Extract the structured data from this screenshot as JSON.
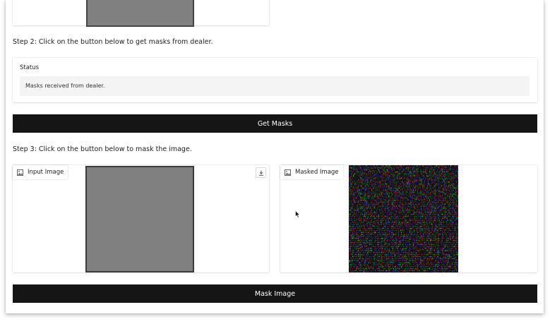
{
  "step2": {
    "instruction": "Step 2: Click on the button below to get masks from dealer."
  },
  "status": {
    "label": "Status",
    "message": "Masks received from dealer."
  },
  "get_masks": {
    "label": "Get Masks"
  },
  "step3": {
    "instruction": "Step 3: Click on the button below to mask the image."
  },
  "input_image": {
    "label": "Input Image",
    "image_icon": "image-icon",
    "download_icon": "download-icon"
  },
  "masked_image": {
    "label": "Masked Image",
    "image_icon": "image-icon"
  },
  "mask_image": {
    "label": "Mask Image"
  },
  "colors": {
    "button_bg": "#151515",
    "button_text": "#ffffff",
    "status_bg": "#f4f4f4"
  }
}
